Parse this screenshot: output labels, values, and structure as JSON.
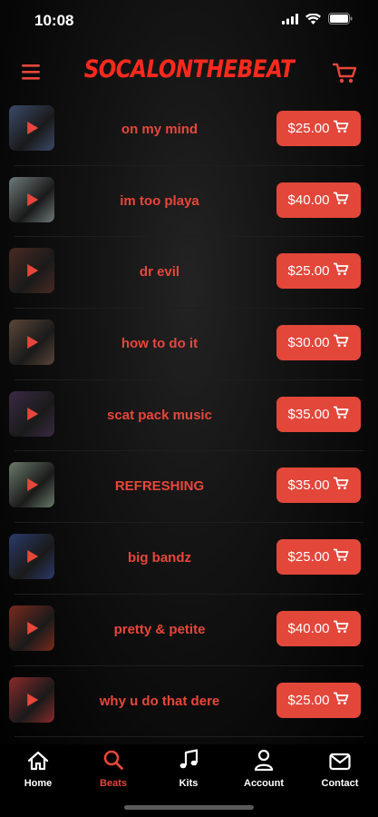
{
  "status_bar": {
    "time": "10:08"
  },
  "header": {
    "brand": "SOCALONTHEBEAT"
  },
  "beats": [
    {
      "title": "on my mind",
      "price": "$25.00",
      "thumb_color": "#3a4a6a"
    },
    {
      "title": "im too playa",
      "price": "$40.00",
      "thumb_color": "#6e7a7a"
    },
    {
      "title": "dr evil",
      "price": "$25.00",
      "thumb_color": "#4a2a22"
    },
    {
      "title": "how to do it",
      "price": "$30.00",
      "thumb_color": "#5a4638"
    },
    {
      "title": "scat pack music",
      "price": "$35.00",
      "thumb_color": "#3a2a44"
    },
    {
      "title": "REFRESHING",
      "price": "$35.00",
      "thumb_color": "#6a7a6a"
    },
    {
      "title": "big bandz",
      "price": "$25.00",
      "thumb_color": "#2a3a6a"
    },
    {
      "title": "pretty & petite",
      "price": "$40.00",
      "thumb_color": "#7a2a1e"
    },
    {
      "title": "why u do that dere",
      "price": "$25.00",
      "thumb_color": "#8a2a2a"
    }
  ],
  "tabs": [
    {
      "label": "Home",
      "icon": "home-icon"
    },
    {
      "label": "Beats",
      "icon": "search-icon",
      "active": true
    },
    {
      "label": "Kits",
      "icon": "music-note-icon"
    },
    {
      "label": "Account",
      "icon": "person-icon"
    },
    {
      "label": "Contact",
      "icon": "mail-icon"
    }
  ],
  "colors": {
    "accent": "#e8463a",
    "brand": "#ff2a1e",
    "background": "#000000"
  }
}
